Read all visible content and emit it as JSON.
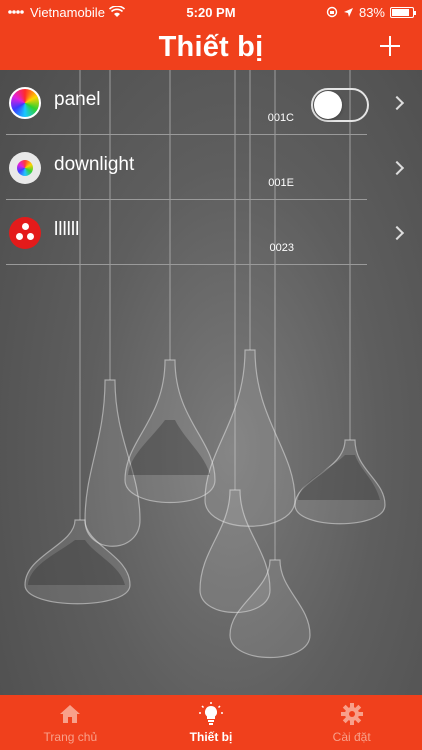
{
  "status_bar": {
    "carrier": "Vietnamobile",
    "time": "5:20 PM",
    "battery": "83%",
    "battery_level": 0.83
  },
  "header": {
    "title": "Thiết bị"
  },
  "devices": [
    {
      "name": "panel",
      "id": "001C",
      "icon": "rgb-panel-icon",
      "has_toggle": true,
      "toggle_on": false
    },
    {
      "name": "downlight",
      "id": "001E",
      "icon": "rgb-downlight-icon"
    },
    {
      "name": "llllll",
      "id": "0023",
      "icon": "three-dot-light-icon"
    }
  ],
  "tabs": [
    {
      "label": "Trang chủ",
      "icon": "home-icon",
      "active": false
    },
    {
      "label": "Thiết bị",
      "icon": "bulb-icon",
      "active": true
    },
    {
      "label": "Cài đặt",
      "icon": "gear-icon",
      "active": false
    }
  ],
  "colors": {
    "accent": "#f0401c",
    "tab_inactive": "#f8a08a"
  }
}
